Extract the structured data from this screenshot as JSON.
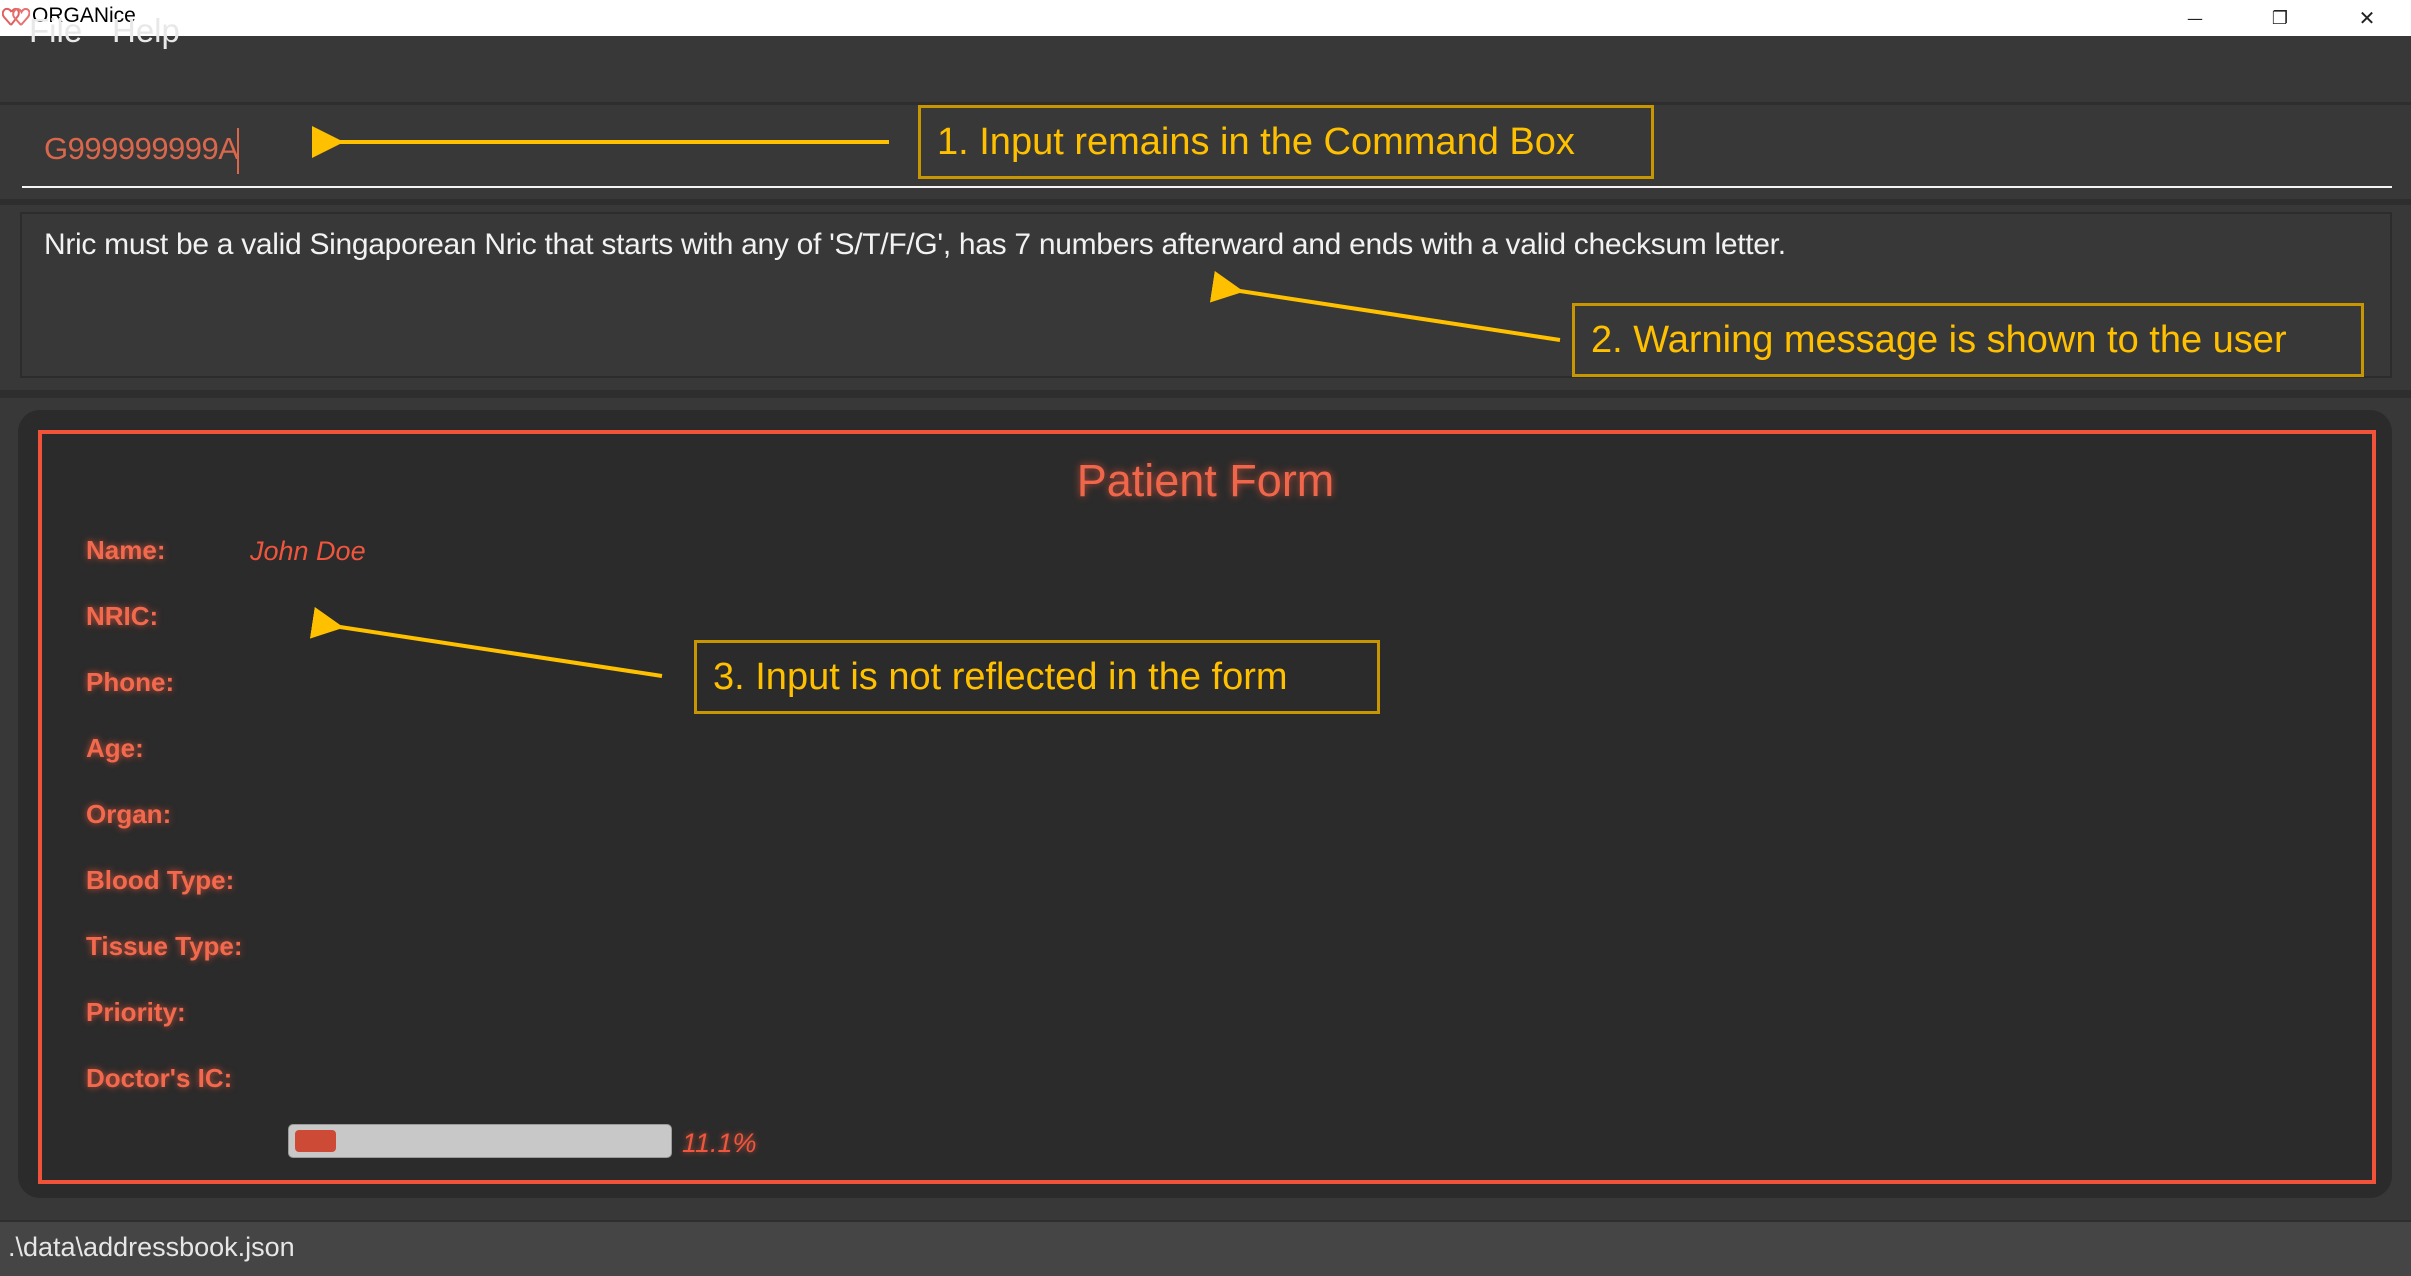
{
  "window": {
    "title": "ORGANice",
    "icon": "heart-icon",
    "controls": {
      "minimize": "—",
      "maximize": "❐",
      "close": "✕"
    }
  },
  "menu": {
    "items": [
      {
        "label": "File"
      },
      {
        "label": "Help"
      }
    ]
  },
  "command_box": {
    "value": "G999999999A"
  },
  "result_display": {
    "message": "Nric must be a valid Singaporean Nric that starts with any of 'S/T/F/G', has 7 numbers afterward and ends with a valid checksum letter."
  },
  "form": {
    "title": "Patient Form",
    "fields": [
      {
        "label": "Name:",
        "value": "John Doe"
      },
      {
        "label": "NRIC:",
        "value": ""
      },
      {
        "label": "Phone:",
        "value": ""
      },
      {
        "label": "Age:",
        "value": ""
      },
      {
        "label": "Organ:",
        "value": ""
      },
      {
        "label": "Blood Type:",
        "value": ""
      },
      {
        "label": "Tissue Type:",
        "value": ""
      },
      {
        "label": "Priority:",
        "value": ""
      },
      {
        "label": "Doctor's IC:",
        "value": ""
      }
    ],
    "progress": {
      "percent": 11.1,
      "label": "11.1%"
    }
  },
  "status_bar": {
    "path": ".\\data\\addressbook.json"
  },
  "annotations": [
    {
      "label": "1. Input remains in the Command Box"
    },
    {
      "label": "2. Warning message is shown to the user"
    },
    {
      "label": "3. Input is not reflected in the form"
    }
  ],
  "colors": {
    "accent": "#f0533a",
    "annotation": "#ffc000",
    "command_text": "#d9674c",
    "background": "#383838",
    "form_background": "#2b2b2b"
  }
}
